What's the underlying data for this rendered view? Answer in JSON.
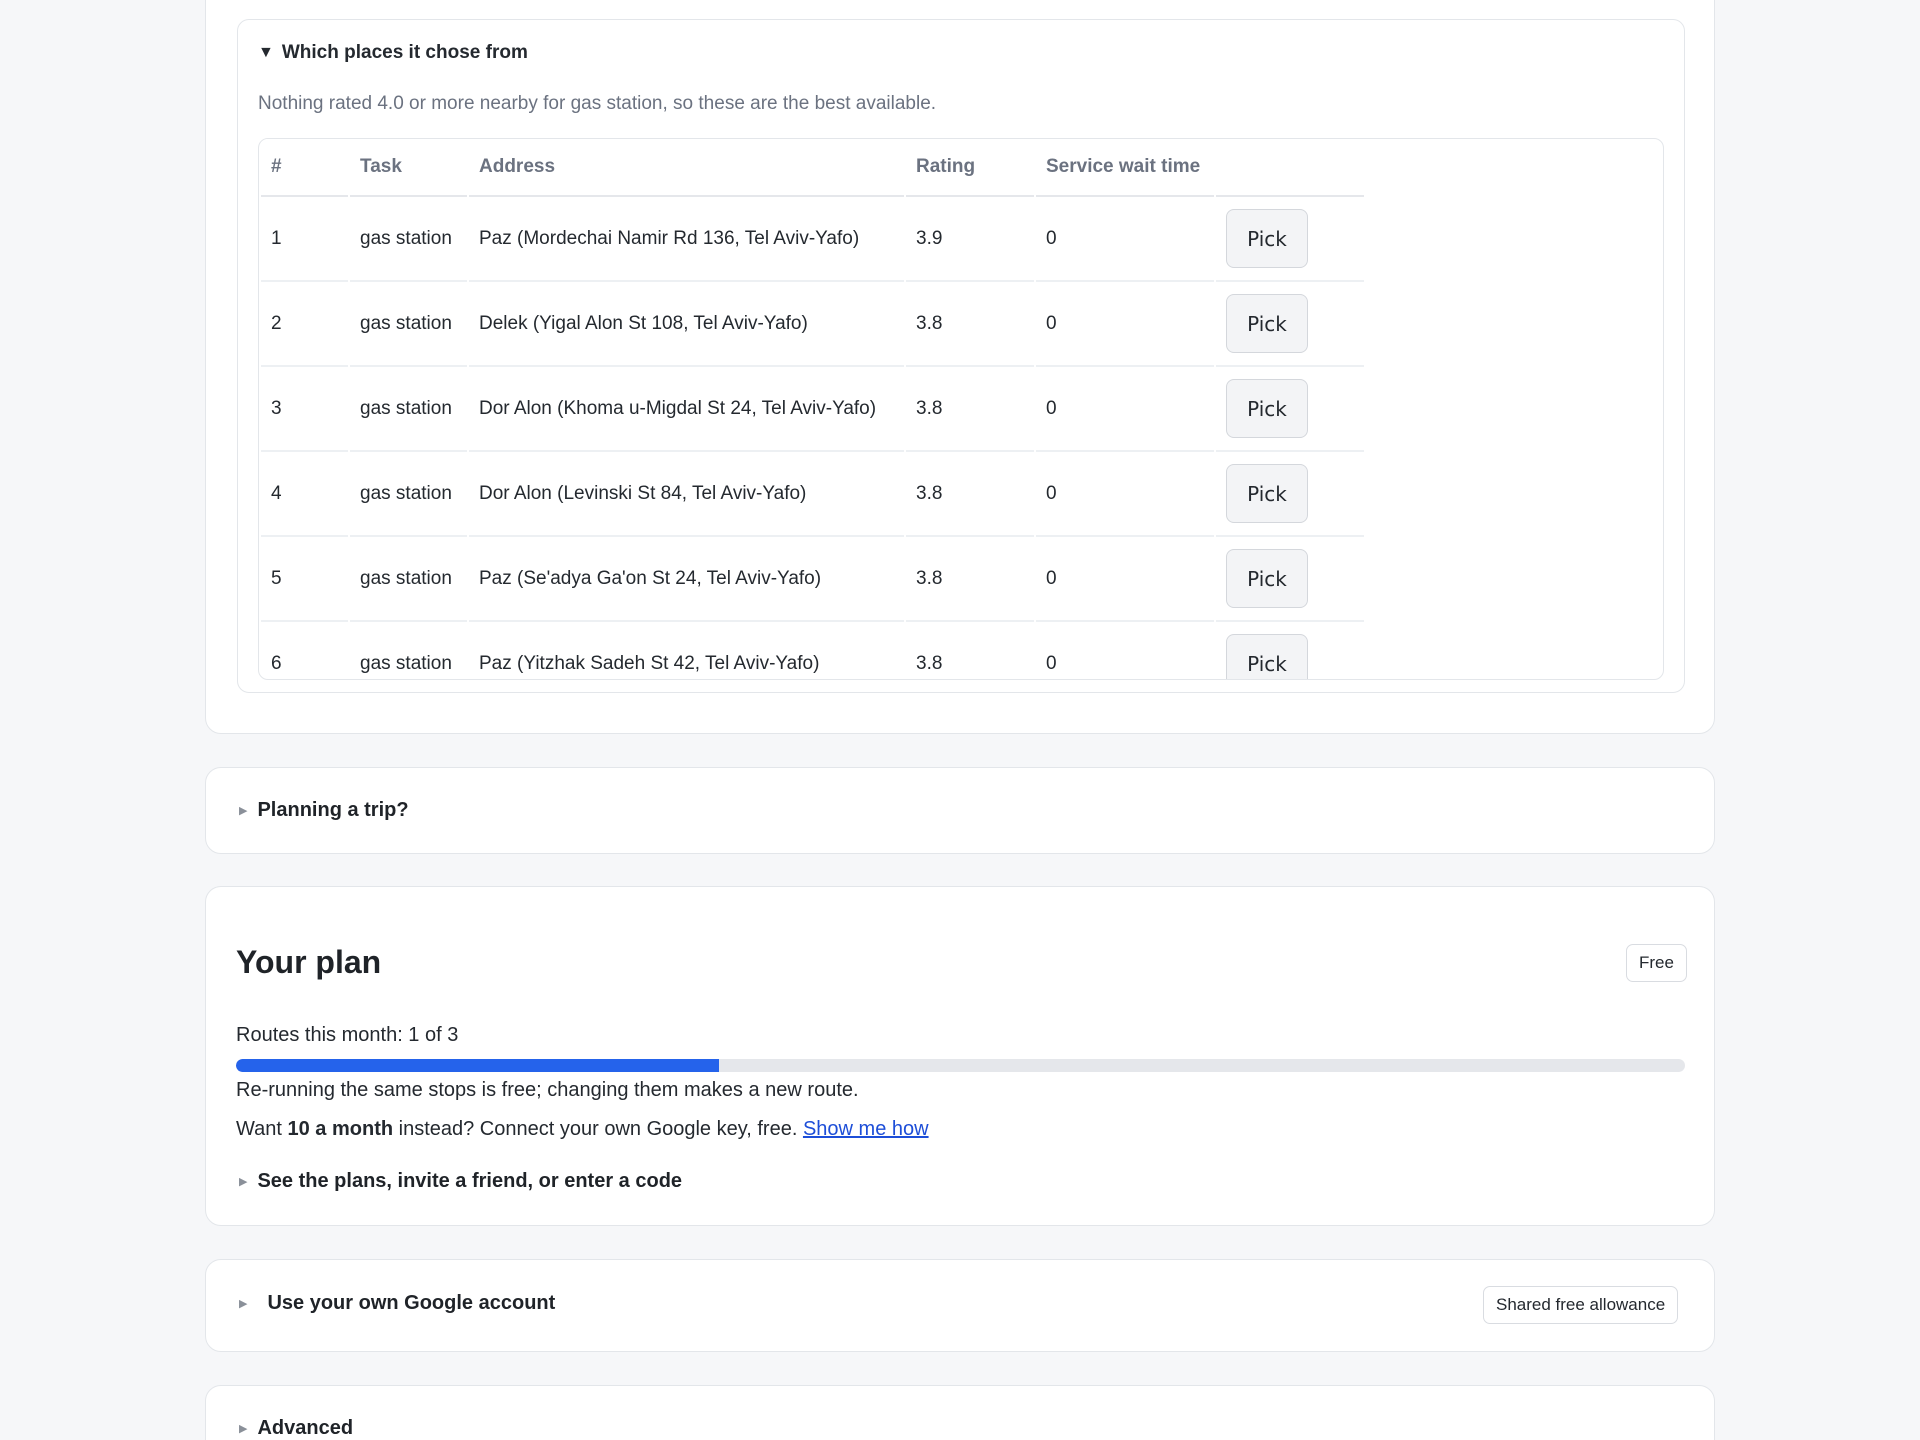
{
  "top_buttons": [
    "",
    "",
    ""
  ],
  "places": {
    "summary": "Which places it chose from",
    "note": "Nothing rated 4.0 or more nearby for gas station, so these are the best available.",
    "columns": [
      "#",
      "Task",
      "Address",
      "Rating",
      "Service wait time",
      ""
    ],
    "pick_label": "Pick",
    "rows": [
      {
        "n": "1",
        "task": "gas station",
        "address": "Paz (Mordechai Namir Rd 136, Tel Aviv-Yafo)",
        "rating": "3.9",
        "wait": "0"
      },
      {
        "n": "2",
        "task": "gas station",
        "address": "Delek (Yigal Alon St 108, Tel Aviv-Yafo)",
        "rating": "3.8",
        "wait": "0"
      },
      {
        "n": "3",
        "task": "gas station",
        "address": "Dor Alon (Khoma u-Migdal St 24, Tel Aviv-Yafo)",
        "rating": "3.8",
        "wait": "0"
      },
      {
        "n": "4",
        "task": "gas station",
        "address": "Dor Alon (Levinski St 84, Tel Aviv-Yafo)",
        "rating": "3.8",
        "wait": "0"
      },
      {
        "n": "5",
        "task": "gas station",
        "address": "Paz (Se'adya Ga'on St 24, Tel Aviv-Yafo)",
        "rating": "3.8",
        "wait": "0"
      },
      {
        "n": "6",
        "task": "gas station",
        "address": "Paz (Yitzhak Sadeh St 42, Tel Aviv-Yafo)",
        "rating": "3.8",
        "wait": "0"
      }
    ]
  },
  "trip": {
    "label": "Planning a trip?"
  },
  "plan": {
    "title": "Your plan",
    "badge": "Free",
    "routes_text": "Routes this month: 1 of 3",
    "routes_used": 1,
    "routes_total": 3,
    "rerun_note": "Re-running the same stops is free; changing them makes a new route.",
    "want_prefix": "Want ",
    "want_bold": "10 a month",
    "want_suffix": " instead? Connect your own Google key, free. ",
    "show_me_how": "Show me how",
    "plans_toggle": "See the plans, invite a friend, or enter a code"
  },
  "google": {
    "label": "Use your own Google account",
    "badge": "Shared free allowance"
  },
  "advanced": {
    "label": "Advanced"
  },
  "colors": {
    "accent": "#2563eb",
    "success": "#22c55e",
    "link": "#1d4ed8"
  }
}
